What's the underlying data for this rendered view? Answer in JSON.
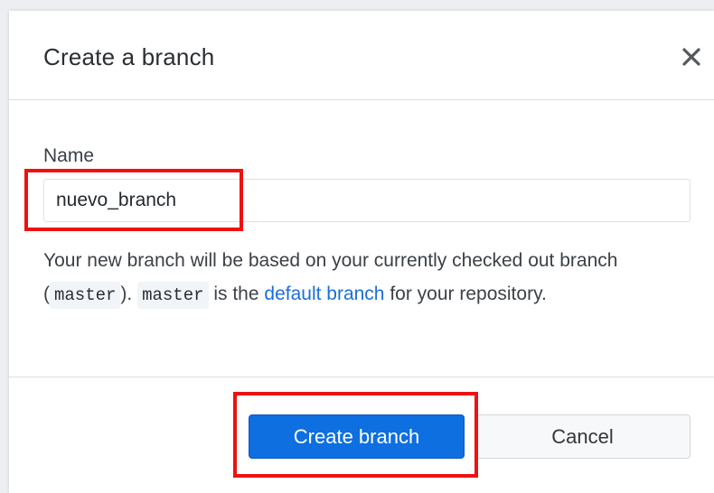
{
  "dialog": {
    "title": "Create a branch",
    "close_icon": "close-icon"
  },
  "form": {
    "name_label": "Name",
    "name_value": "nuevo_branch"
  },
  "help": {
    "part1": "Your new branch will be based on your currently checked out branch (",
    "current_branch": "master",
    "part2": "). ",
    "default_branch_code": "master",
    "part3": " is the ",
    "link_text": "default branch",
    "part4": " for your repository."
  },
  "actions": {
    "create_label": "Create branch",
    "cancel_label": "Cancel"
  },
  "colors": {
    "primary": "#0e6fe0",
    "highlight": "#ee1111",
    "link": "#1a6fd8"
  }
}
